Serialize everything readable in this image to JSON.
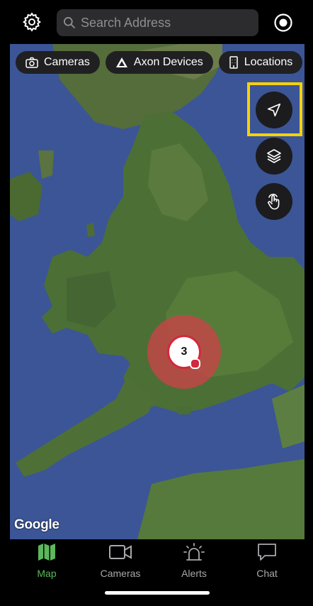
{
  "search": {
    "placeholder": "Search Address"
  },
  "filters": [
    {
      "label": "Cameras",
      "icon": "camera-icon"
    },
    {
      "label": "Axon Devices",
      "icon": "axon-logo-icon"
    },
    {
      "label": "Locations",
      "icon": "building-icon"
    }
  ],
  "map_controls": {
    "locate": "navigation-arrow-icon",
    "layers": "layers-icon",
    "gesture": "hand-tap-icon",
    "highlight_color": "#f5d20a"
  },
  "cluster": {
    "count": "3",
    "color": "#d3283d"
  },
  "attribution": "Google",
  "tabs": [
    {
      "label": "Map",
      "icon": "map-icon",
      "active": true
    },
    {
      "label": "Cameras",
      "icon": "video-camera-icon",
      "active": false
    },
    {
      "label": "Alerts",
      "icon": "alert-beacon-icon",
      "active": false
    },
    {
      "label": "Chat",
      "icon": "chat-bubble-icon",
      "active": false
    }
  ],
  "colors": {
    "active_tab": "#5cb85c",
    "sea": "#3b5597",
    "land": "#4c6f36"
  }
}
